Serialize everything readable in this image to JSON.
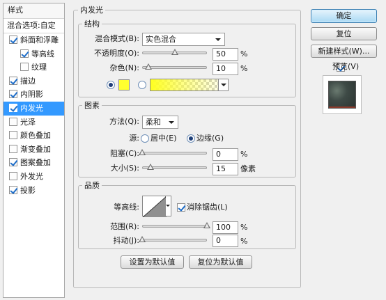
{
  "styles_panel": {
    "header": "样式",
    "blending_options": "混合选项:自定",
    "items": [
      {
        "label": "斜面和浮雕",
        "checked": true
      },
      {
        "label": "等高线",
        "checked": true
      },
      {
        "label": "纹理",
        "checked": false
      },
      {
        "label": "描边",
        "checked": true
      },
      {
        "label": "内阴影",
        "checked": true
      },
      {
        "label": "内发光",
        "checked": true
      },
      {
        "label": "光泽",
        "checked": false
      },
      {
        "label": "颜色叠加",
        "checked": false
      },
      {
        "label": "渐变叠加",
        "checked": false
      },
      {
        "label": "图案叠加",
        "checked": true
      },
      {
        "label": "外发光",
        "checked": false
      },
      {
        "label": "投影",
        "checked": true
      }
    ],
    "selected": "内发光"
  },
  "main_title": "内发光",
  "structure": {
    "title": "结构",
    "blend_mode_label": "混合模式(B):",
    "blend_mode_value": "实色混合",
    "opacity_label": "不透明度(O):",
    "opacity_value": "50",
    "opacity_unit": "%",
    "opacity_level": 0.5,
    "noise_label": "杂色(N):",
    "noise_value": "10",
    "noise_unit": "%",
    "noise_level": 0.1,
    "color_swatch": "#ffff2e",
    "color_option_selected": "solid-color"
  },
  "elements": {
    "title": "图素",
    "technique_label": "方法(Q):",
    "technique_value": "柔和",
    "source_label": "源:",
    "source_center": "居中(E)",
    "source_edge": "边缘(G)",
    "source_selected": "edge",
    "choke_label": "阻塞(C):",
    "choke_value": "0",
    "choke_unit": "%",
    "choke_level": 0,
    "size_label": "大小(S):",
    "size_value": "15",
    "size_unit": "像素"
  },
  "quality": {
    "title": "品质",
    "contour_label": "等高线:",
    "anti_alias_label": "消除锯齿(L)",
    "anti_alias_checked": true,
    "range_label": "范围(R):",
    "range_value": "100",
    "range_unit": "%",
    "range_level": 1.0,
    "jitter_label": "抖动(J):",
    "jitter_value": "0",
    "jitter_unit": "%",
    "jitter_level": 0
  },
  "bottom_buttons": {
    "make_default": "设置为默认值",
    "reset_default": "复位为默认值"
  },
  "right_buttons": {
    "ok": "确定",
    "reset": "复位",
    "new_style": "新建样式(W)...",
    "preview_label": "预览(V)",
    "preview_checked": true
  }
}
